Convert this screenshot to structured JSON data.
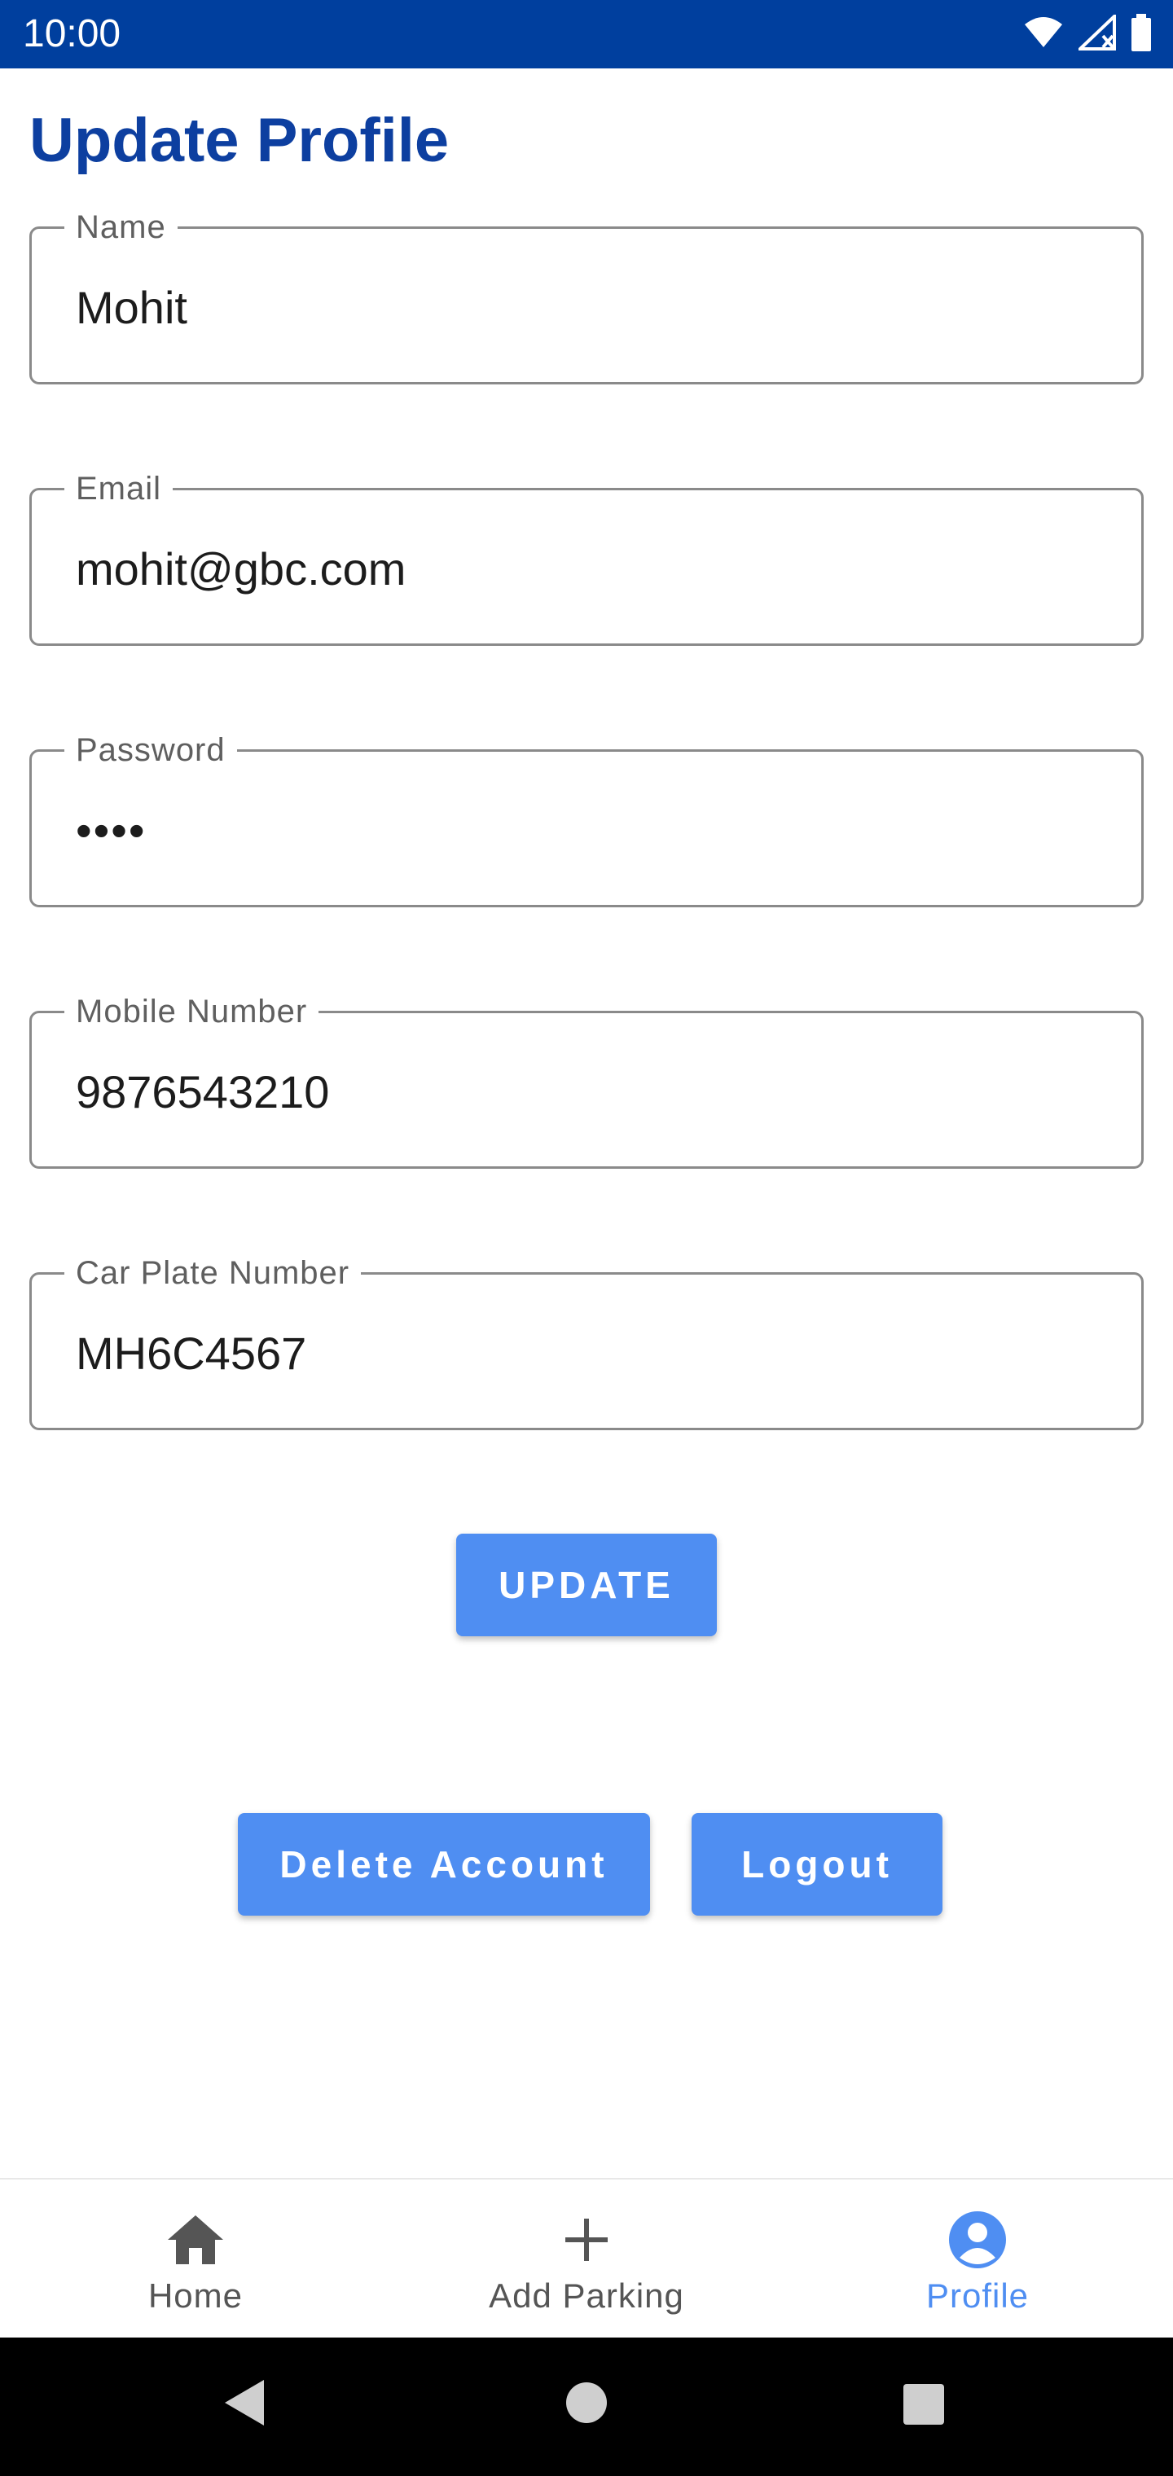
{
  "status_bar": {
    "time": "10:00",
    "icons": [
      "wifi-icon",
      "signal-icon",
      "battery-icon"
    ]
  },
  "page": {
    "title": "Update Profile"
  },
  "form": {
    "fields": [
      {
        "label": "Name",
        "value": "Mohit"
      },
      {
        "label": "Email",
        "value": "mohit@gbc.com"
      },
      {
        "label": "Password",
        "value": "••••"
      },
      {
        "label": "Mobile Number",
        "value": "9876543210"
      },
      {
        "label": "Car Plate Number",
        "value": "MH6C4567"
      }
    ],
    "update_label": "UPDATE"
  },
  "actions": {
    "delete_label": "Delete Account",
    "logout_label": "Logout"
  },
  "bottom_nav": {
    "items": [
      {
        "label": "Home",
        "icon": "home-icon"
      },
      {
        "label": "Add Parking",
        "icon": "plus-icon"
      },
      {
        "label": "Profile",
        "icon": "account-circle-icon"
      }
    ],
    "active": "Profile"
  },
  "system_nav": {
    "icons": [
      "back-icon",
      "home-circle-icon",
      "recents-icon"
    ]
  },
  "colors": {
    "status_bar": "#003f9e",
    "title": "#0d3fa0",
    "accent": "#4f8ef2",
    "field_border": "#8a8a8a"
  }
}
